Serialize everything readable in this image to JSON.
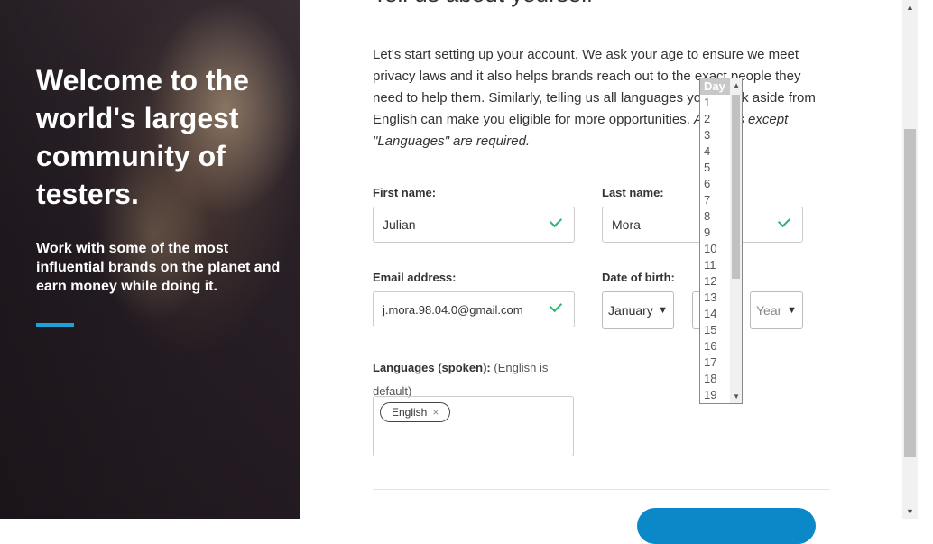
{
  "hero": {
    "title": "Welcome to the world's largest community of testers.",
    "subtitle": "Work with some of the most influential brands on the planet and earn money while doing it."
  },
  "main": {
    "heading": "Tell us about yourself",
    "intro_text": "Let's start setting up your account. We ask your age to ensure we meet privacy laws and it also helps brands reach out to the exact people they need to help them. Similarly, telling us all languages you speak aside from English can make you eligible for more opportunities.",
    "intro_italic": "All fields except \"Languages\" are required."
  },
  "form": {
    "first_name_label": "First name:",
    "first_name_value": "Julian",
    "last_name_label": "Last name:",
    "last_name_value": "Mora",
    "email_label": "Email address:",
    "email_value": "j.mora.98.04.0@gmail.com",
    "dob_label": "Date of birth:",
    "month_value": "January",
    "year_value": "Year",
    "languages_label": "Languages (spoken):",
    "languages_hint": "(English is default)",
    "language_chip": "English",
    "chip_remove": "×"
  },
  "day_dropdown": {
    "options": [
      "Day",
      "1",
      "2",
      "3",
      "4",
      "5",
      "6",
      "7",
      "8",
      "9",
      "10",
      "11",
      "12",
      "13",
      "14",
      "15",
      "16",
      "17",
      "18",
      "19"
    ]
  },
  "colors": {
    "accent": "#1da1d6",
    "button": "#0a88c8",
    "check": "#2bb673"
  }
}
